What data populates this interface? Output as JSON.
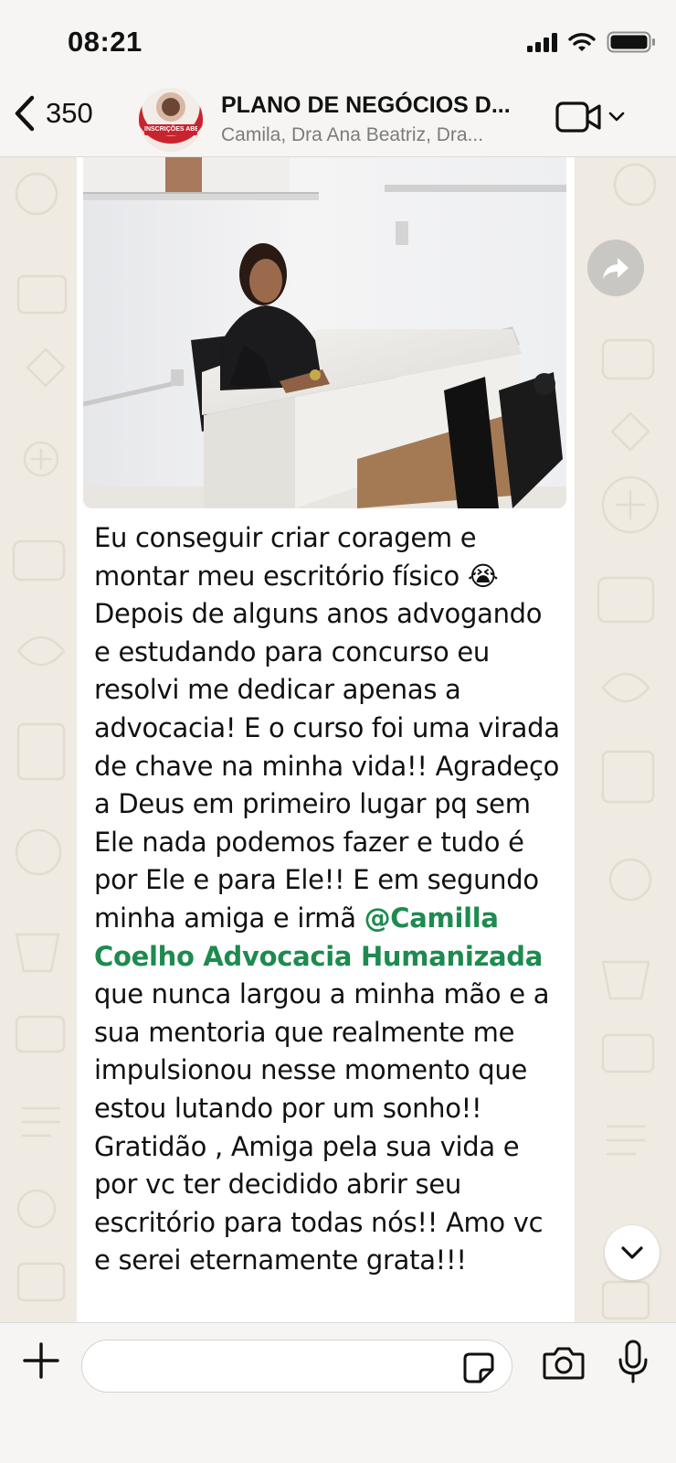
{
  "status_bar": {
    "time": "08:21"
  },
  "header": {
    "back_count": "350",
    "group_title": "PLANO DE NEGÓCIOS D...",
    "group_members": "Camila, Dra Ana Beatriz, Dra...",
    "avatar_text": "INSCRIÇÕES ABERTAS"
  },
  "message": {
    "part1": "Eu conseguir criar coragem e montar meu escritório físico 😭 Depois de alguns anos advogando e estudando para concurso eu resolvi me dedicar apenas a advocacia! E o curso foi uma virada de chave na minha vida!! Agradeço a Deus em primeiro lugar pq sem Ele nada podemos fazer e tudo é por Ele e para Ele!! E em segundo minha amiga e irmã ",
    "mention": "@Camilla Coelho Advocacia Humanizada",
    "part2": " que nunca largou a minha mão e a sua mentoria que realmente me impulsionou nesse momento que estou lutando por um sonho!! Gratidão , Amiga pela sua vida e por vc ter decidido abrir seu escritório para todas nós!! Amo vc e serei eternamente grata!!!"
  },
  "composer": {
    "placeholder": "",
    "value": ""
  },
  "colors": {
    "chat_bg": "#efeae2",
    "header_bg": "#f6f5f3",
    "mention": "#1e8a4f",
    "bubble": "#ffffff"
  },
  "icons": [
    "back-chevron-icon",
    "video-camera-icon",
    "chevron-down-icon",
    "forward-icon",
    "scroll-down-icon",
    "plus-icon",
    "sticker-icon",
    "camera-icon",
    "microphone-icon",
    "signal-icon",
    "wifi-icon",
    "battery-icon"
  ]
}
